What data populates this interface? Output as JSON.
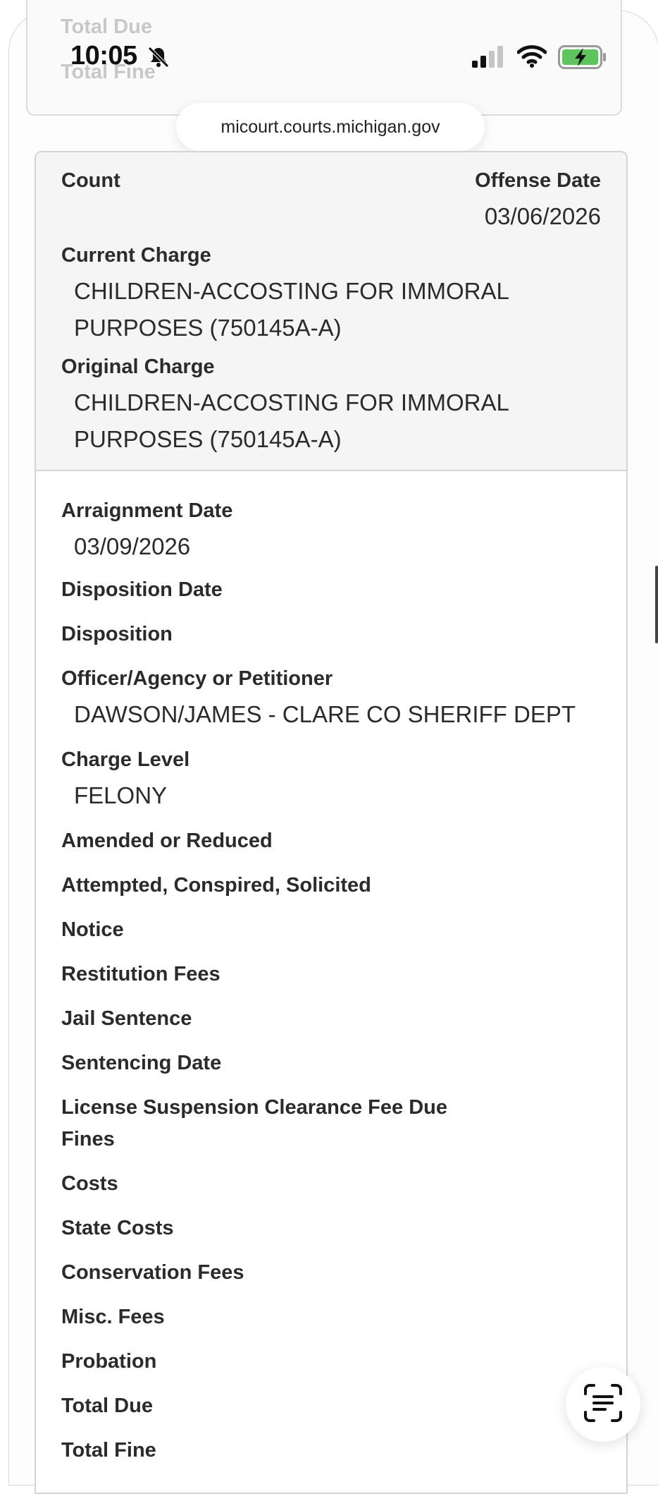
{
  "status_bar": {
    "time": "10:05",
    "icons": [
      "bell-slash-icon",
      "signal-icon",
      "wifi-icon",
      "battery-charging-icon"
    ],
    "battery_color": "#5ec45e"
  },
  "browser": {
    "url": "micourt.courts.michigan.gov"
  },
  "previous_record": {
    "total_due_label": "Total Due",
    "total_fine_label": "Total Fine"
  },
  "charge": {
    "count_label": "Count",
    "offense_date_label": "Offense Date",
    "offense_date": "03/06/2026",
    "current_charge_label": "Current Charge",
    "current_charge_line1": "CHILDREN-ACCOSTING FOR IMMORAL",
    "current_charge_line2": "PURPOSES (750145A-A)",
    "original_charge_label": "Original Charge",
    "original_charge_line1": "CHILDREN-ACCOSTING FOR IMMORAL",
    "original_charge_line2": "PURPOSES (750145A-A)"
  },
  "details": {
    "arraignment_date_label": "Arraignment Date",
    "arraignment_date": "03/09/2026",
    "disposition_date_label": "Disposition Date",
    "disposition_label": "Disposition",
    "officer_label": "Officer/Agency or Petitioner",
    "officer": "DAWSON/JAMES - CLARE CO SHERIFF DEPT",
    "charge_level_label": "Charge Level",
    "charge_level": "FELONY",
    "amended_label": "Amended or Reduced",
    "attempted_label": "Attempted, Conspired, Solicited",
    "notice_label": "Notice",
    "restitution_label": "Restitution Fees",
    "jail_label": "Jail Sentence",
    "sentencing_label": "Sentencing Date",
    "license_fee_label": "License Suspension Clearance Fee Due",
    "fines_label": "Fines",
    "costs_label": "Costs",
    "state_costs_label": "State Costs",
    "conservation_label": "Conservation Fees",
    "misc_label": "Misc. Fees",
    "probation_label": "Probation",
    "total_due_label": "Total Due",
    "total_fine_label": "Total Fine"
  },
  "scan_button": {
    "icon": "text-scan-icon"
  }
}
